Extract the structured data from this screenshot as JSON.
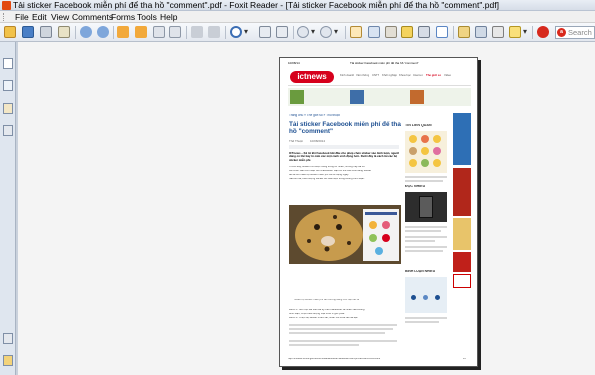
{
  "window": {
    "title": "Tải sticker Facebook miễn phí để tha hồ \"comment\".pdf - Foxit Reader - [Tải sticker Facebook miễn phí để tha hồ \"comment\".pdf]"
  },
  "menu": [
    "File",
    "Edit",
    "View",
    "Comments",
    "Forms",
    "Tools",
    "Help"
  ],
  "toolbar": {
    "zoom_label": "Q",
    "search_placeholder": "Search do"
  },
  "colors": {
    "brand": "#e24a12",
    "ictnews_red": "#d6001c",
    "link_blue": "#1d4f91"
  },
  "pdf": {
    "header_left": "10/08/14",
    "header_center": "Tải sticker Facebook miễn phí để tha hồ \"comment\"",
    "logo_text": "ictnews",
    "nav_items": [
      "Kinh doanh",
      "Viễn thông",
      "CNTT",
      "Khởi nghiệp",
      "Khoa học",
      "Internet",
      "Thế giới số",
      "Video"
    ],
    "nav_active": "Thế giới số",
    "breadcrumb": "Trang chủ » Thế giới số » Thủ thuật",
    "article_title": "Tải sticker Facebook miễn phí để tha hồ \"comment\"",
    "byline": "Thế Thuật",
    "date": "10/08/2014",
    "sapo": "ICTnews – Kể từ khi Facebook bắt đầu cho phép chèn sticker vào bình luận, người dùng có thể bày tỏ cảm xúc một cách sinh động hơn. Dưới đây là cách tải các bộ sticker miễn phí.",
    "body_lines": [
      "Trước đây, sticker chỉ được dùng trong tin nhắn, nhưng nay đã có",
      "thể chèn vào bình luận trên Facebook. Bạn có thể vào cửa hàng sticker",
      "để tải về nhiều bộ sticker miễn phí và sử dụng ngay.",
      "Sau khi tải, biểu tượng sticker sẽ xuất hiện trong khung bình luận."
    ],
    "caption": "Nhiều bộ sticker miễn phí dễ thương đang chờ bạn tải về",
    "body2_lines": [
      "Bước 1: Mở một bài viết bất kỳ trên Facebook và nhấn vào khung",
      "bình luận, chọn biểu tượng mặt cười ở góc phải.",
      "Bước 2: Chọn bộ sticker muốn tải, nhấn nút Free để cài đặt."
    ],
    "sidebar": {
      "related_title": "TIN LIÊN QUAN",
      "most_read_title": "ĐỌC NHIỀU",
      "most_comment_title": "BÌNH LUẬN NHIỀU"
    },
    "footer_left": "http://ictnews.vn/the-gioi-so/thu-thuat/tai-sticker-facebook-mien-phi-de-tha-ho-comment",
    "footer_right": "1/5"
  }
}
